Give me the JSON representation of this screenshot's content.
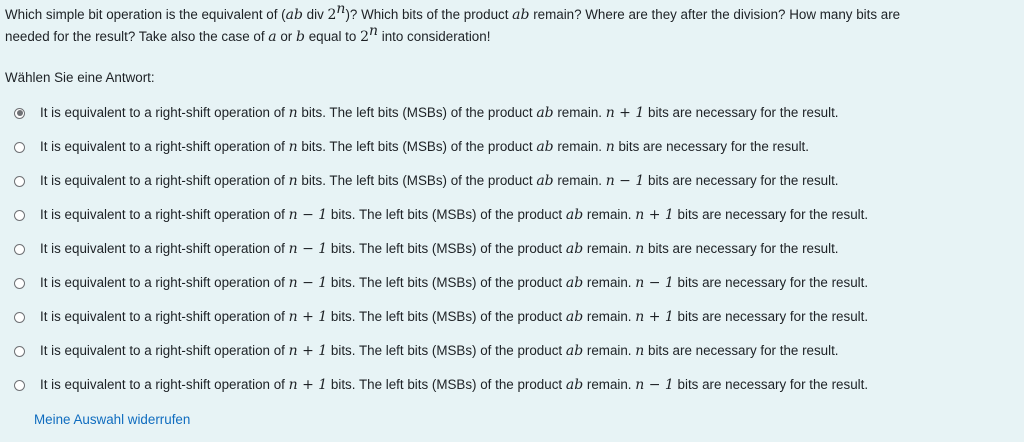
{
  "question": {
    "line1_a": "Which simple bit operation is the equivalent of (",
    "line1_ab": "ab",
    "line1_div": " div ",
    "line1_two": "2",
    "line1_n": "n",
    "line1_b": ")? Which bits of the product ",
    "line1_ab2": "ab",
    "line1_c": " remain? Where are they after the division? How many bits are",
    "line2_a": "needed for the result? Take also the case of ",
    "line2_var_a": "a",
    "line2_or": " or ",
    "line2_var_b": "b",
    "line2_b": " equal to ",
    "line2_two": "2",
    "line2_n": "n",
    "line2_c": " into consideration!"
  },
  "prompt": "Wählen Sie eine Antwort:",
  "options": [
    {
      "shift": "n",
      "need": "n + 1",
      "selected": true
    },
    {
      "shift": "n",
      "need": "n",
      "selected": false
    },
    {
      "shift": "n",
      "need": "n − 1",
      "selected": false
    },
    {
      "shift": "n − 1",
      "need": "n + 1",
      "selected": false
    },
    {
      "shift": "n − 1",
      "need": "n",
      "selected": false
    },
    {
      "shift": "n − 1",
      "need": "n − 1",
      "selected": false
    },
    {
      "shift": "n + 1",
      "need": "n + 1",
      "selected": false
    },
    {
      "shift": "n + 1",
      "need": "n",
      "selected": false
    },
    {
      "shift": "n + 1",
      "need": "n − 1",
      "selected": false
    }
  ],
  "text": {
    "part1": "It is equivalent to a right-shift operation of ",
    "part2": " bits. The left bits (MSBs) of the product ",
    "ab": "ab",
    "part3": " remain. ",
    "part4": " bits are necessary for the result."
  },
  "clear_choice": "Meine Auswahl widerrufen",
  "colors": {
    "background": "#e7f3f5",
    "link": "#0f6cbf",
    "text": "#1d2125"
  }
}
